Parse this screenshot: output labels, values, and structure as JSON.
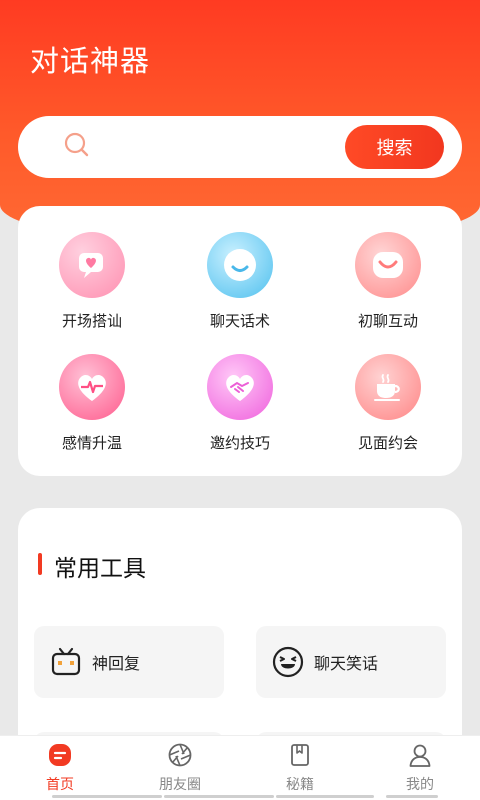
{
  "app": {
    "title": "对话神器"
  },
  "search": {
    "button_label": "搜索",
    "placeholder": ""
  },
  "features": [
    {
      "label": "开场搭讪",
      "icon": "heart-chat-icon",
      "color": "#ff8fb0"
    },
    {
      "label": "聊天话术",
      "icon": "smile-chat-icon",
      "color": "#5cc8f2"
    },
    {
      "label": "初聊互动",
      "icon": "smile-icon",
      "color": "#ff8c8c"
    },
    {
      "label": "感情升温",
      "icon": "heartbeat-icon",
      "color": "#ff5d8f"
    },
    {
      "label": "邀约技巧",
      "icon": "handshake-icon",
      "color": "#f26be0"
    },
    {
      "label": "见面约会",
      "icon": "coffee-cup-icon",
      "color": "#ff8585"
    }
  ],
  "tools_section": {
    "title": "常用工具"
  },
  "tools": [
    {
      "label": "神回复",
      "icon": "tv-chat-icon"
    },
    {
      "label": "聊天笑话",
      "icon": "laughing-face-icon"
    }
  ],
  "tabbar": [
    {
      "label": "首页",
      "icon": "home-icon",
      "active": true
    },
    {
      "label": "朋友圈",
      "icon": "aperture-icon",
      "active": false
    },
    {
      "label": "秘籍",
      "icon": "book-icon",
      "active": false
    },
    {
      "label": "我的",
      "icon": "user-icon",
      "active": false
    }
  ]
}
